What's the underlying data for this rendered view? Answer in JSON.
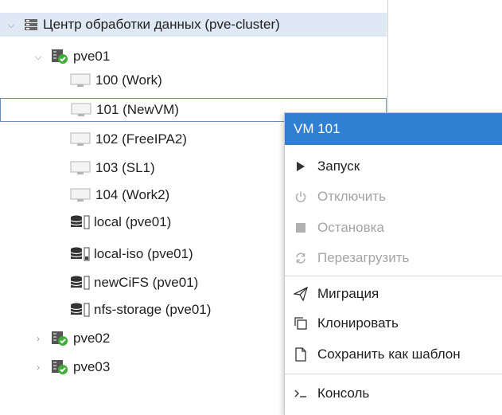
{
  "tree": {
    "datacenter": {
      "label": "Центр обработки данных (pve-cluster)",
      "icon": "server-rack-icon"
    },
    "nodes": [
      {
        "label": "pve01",
        "icon": "node-online-icon",
        "expanded": true
      },
      {
        "label": "pve02",
        "icon": "node-online-icon",
        "expanded": false
      },
      {
        "label": "pve03",
        "icon": "node-online-icon",
        "expanded": false
      }
    ],
    "vms": [
      {
        "label": "100 (Work)",
        "icon": "monitor-icon"
      },
      {
        "label": "101 (NewVM)",
        "icon": "monitor-icon",
        "selected": true
      },
      {
        "label": "102 (FreeIPA2)",
        "icon": "monitor-icon"
      },
      {
        "label": "103 (SL1)",
        "icon": "monitor-icon"
      },
      {
        "label": "104 (Work2)",
        "icon": "monitor-icon"
      }
    ],
    "storages": [
      {
        "label": "local (pve01)",
        "icon": "storage-icon"
      },
      {
        "label": "local-iso (pve01)",
        "icon": "storage-icon"
      },
      {
        "label": "newCiFS (pve01)",
        "icon": "storage-icon"
      },
      {
        "label": "nfs-storage (pve01)",
        "icon": "storage-icon"
      }
    ]
  },
  "context_menu": {
    "title": "VM 101",
    "items": [
      {
        "label": "Запуск",
        "icon": "play-icon",
        "disabled": false
      },
      {
        "label": "Отключить",
        "icon": "power-icon",
        "disabled": true
      },
      {
        "label": "Остановка",
        "icon": "stop-icon",
        "disabled": true
      },
      {
        "label": "Перезагрузить",
        "icon": "reload-icon",
        "disabled": true
      },
      {
        "label": "Миграция",
        "icon": "paper-plane-icon",
        "disabled": false
      },
      {
        "label": "Клонировать",
        "icon": "clone-icon",
        "disabled": false
      },
      {
        "label": "Сохранить как шаблон",
        "icon": "file-icon",
        "disabled": false
      },
      {
        "label": "Консоль",
        "icon": "terminal-icon",
        "disabled": false
      }
    ]
  },
  "colors": {
    "accent": "#2f7fd3",
    "selection_bg": "#dfe8f5",
    "node_ok": "#3fae35"
  }
}
